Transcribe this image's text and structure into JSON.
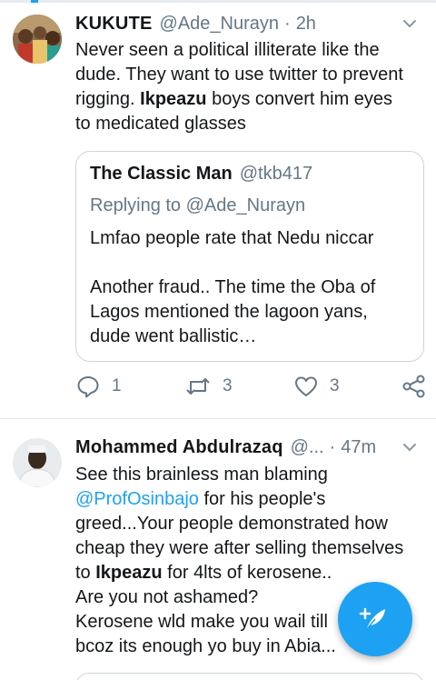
{
  "tweets": [
    {
      "name": "KUKUTE",
      "handle": "@Ade_Nurayn",
      "separator": "·",
      "time": "2h",
      "text_lines": [
        "Never seen a political illiterate like the",
        "dude. They want to use twitter to prevent",
        "rigging. ",
        "Ikpeazu",
        " boys convert him eyes",
        "to medicated glasses"
      ],
      "quote": {
        "name": "The Classic Man",
        "handle": "@tkb417",
        "replying": "Replying to @Ade_Nurayn",
        "line1": "Lmfao people rate that Nedu niccar",
        "para2_lines": [
          "Another fraud.. The time the Oba of",
          "Lagos mentioned the lagoon yans,",
          "dude went ballistic…"
        ]
      },
      "actions": {
        "replies": "1",
        "retweets": "3",
        "likes": "3"
      }
    },
    {
      "name": "Mohammed Abdulrazaq",
      "handle": "@...",
      "separator": "·",
      "time": "47m",
      "text_parts": {
        "l1": "See this brainless man blaming",
        "mention": "@ProfOsinbajo",
        "l2_rest": " for his people's",
        "l3": "greed...Your people demonstrated how",
        "l4": "cheap they were after selling themselves",
        "l5_pre": "to ",
        "l5_bold": "Ikpeazu",
        "l5_post": " for 4lts of kerosene..",
        "l6": "Are you not ashamed?",
        "l7": "Kerosene wld make you wail till",
        "l8": "bcoz its enough yo buy in Abia..."
      }
    }
  ],
  "colors": {
    "accent": "#1da1f2",
    "secondary_text": "#657786",
    "border": "#ccd6dd"
  },
  "icons": {
    "more": "chevron-down-icon",
    "reply": "reply-icon",
    "retweet": "retweet-icon",
    "like": "heart-icon",
    "share": "share-icon",
    "compose": "compose-tweet-icon"
  }
}
